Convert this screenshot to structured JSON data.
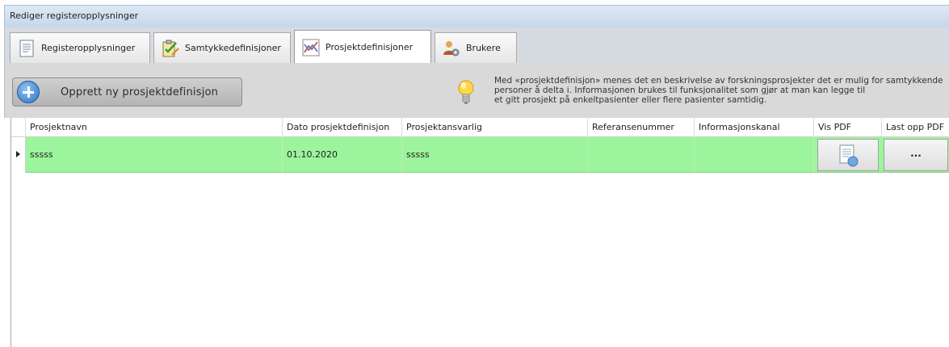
{
  "window": {
    "title": "Rediger registeropplysninger"
  },
  "tabs": [
    {
      "label": "Registeropplysninger",
      "icon": "document-icon",
      "active": false
    },
    {
      "label": "Samtykkedefinisjoner",
      "icon": "checklist-icon",
      "active": false
    },
    {
      "label": "Prosjektdefinisjoner",
      "icon": "chart-icon",
      "active": true
    },
    {
      "label": "Brukere",
      "icon": "users-icon",
      "active": false
    }
  ],
  "toolbar": {
    "create_label": "Opprett ny prosjektdefinisjon",
    "info_lines": [
      "Med «prosjektdefinisjon» menes det en beskrivelse av forskningsprosjekter det er mulig for samtykkende",
      "personer å delta i. Informasjonen brukes til funksjonalitet som gjør at man kan legge til",
      "et gitt prosjekt på enkeltpasienter eller flere pasienter samtidig."
    ]
  },
  "grid": {
    "columns": [
      "Prosjektnavn",
      "Dato prosjektdefinisjon",
      "Prosjektansvarlig",
      "Referansenummer",
      "Informasjonskanal",
      "Vis PDF",
      "Last opp PDF"
    ],
    "rows": [
      {
        "prosjektnavn": "sssss",
        "dato": "01.10.2020",
        "prosjektansvarlig": "sssss",
        "referansenummer": "",
        "informasjonskanal": "",
        "upload_label": "..."
      }
    ],
    "row_color": "#9cf59c"
  }
}
